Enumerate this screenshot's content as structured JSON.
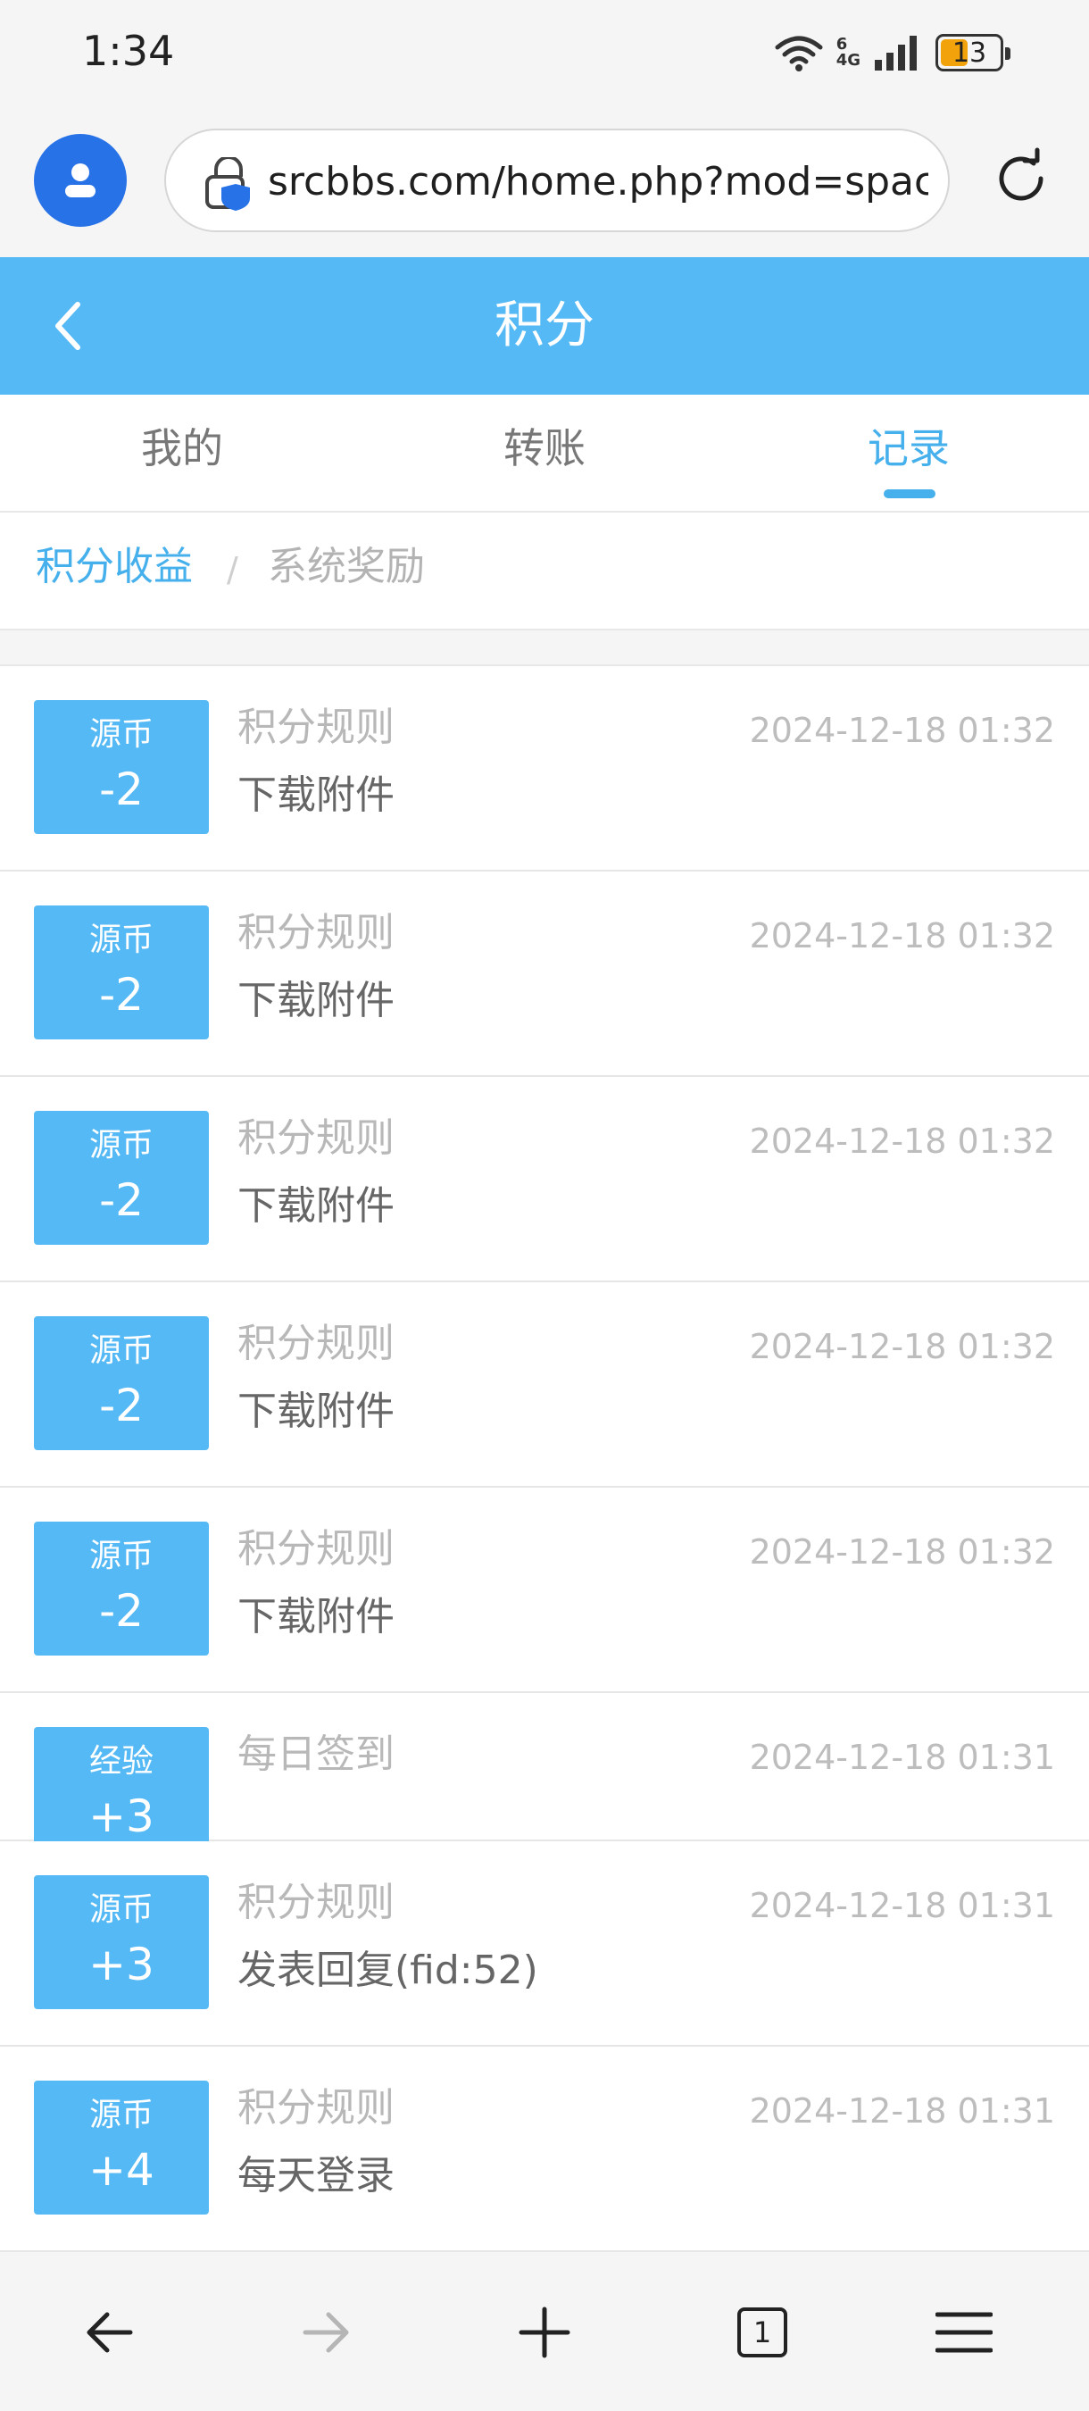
{
  "status": {
    "time": "1:34",
    "network_top": "6",
    "network": "4G",
    "battery": "13",
    "battery_level": 0.13
  },
  "browser": {
    "url": "srcbbs.com/home.php?mod=spacecp&ac=credit&op=log",
    "tab_count": "1"
  },
  "header": {
    "title": "积分"
  },
  "tabs": [
    {
      "label": "我的",
      "active": false
    },
    {
      "label": "转账",
      "active": false
    },
    {
      "label": "记录",
      "active": true
    }
  ],
  "subnav": {
    "link": "积分收益",
    "separator": "/",
    "current": "系统奖励"
  },
  "records": [
    {
      "type": "源币",
      "amount": "-2",
      "label": "积分规则",
      "time": "2024-12-18 01:32",
      "desc": "下载附件"
    },
    {
      "type": "源币",
      "amount": "-2",
      "label": "积分规则",
      "time": "2024-12-18 01:32",
      "desc": "下载附件"
    },
    {
      "type": "源币",
      "amount": "-2",
      "label": "积分规则",
      "time": "2024-12-18 01:32",
      "desc": "下载附件"
    },
    {
      "type": "源币",
      "amount": "-2",
      "label": "积分规则",
      "time": "2024-12-18 01:32",
      "desc": "下载附件"
    },
    {
      "type": "源币",
      "amount": "-2",
      "label": "积分规则",
      "time": "2024-12-18 01:32",
      "desc": "下载附件"
    },
    {
      "type": "经验",
      "amount": "+3",
      "label": "每日签到",
      "time": "2024-12-18 01:31",
      "desc": ""
    },
    {
      "type": "源币",
      "amount": "+3",
      "label": "积分规则",
      "time": "2024-12-18 01:31",
      "desc": "发表回复(fid:52)"
    },
    {
      "type": "源币",
      "amount": "+4",
      "label": "积分规则",
      "time": "2024-12-18 01:31",
      "desc": "每天登录"
    }
  ],
  "colors": {
    "accent": "#55b9f5",
    "active_tab": "#45b0ec",
    "avatar": "#2872e8",
    "battery": "#f2a20a"
  },
  "icons": {
    "back": "chevron-left-icon",
    "reload": "reload-icon",
    "lock": "lock-shield-icon",
    "nav_back": "arrow-left-icon",
    "nav_forward": "arrow-right-icon",
    "new_tab": "plus-icon",
    "menu": "menu-icon"
  }
}
